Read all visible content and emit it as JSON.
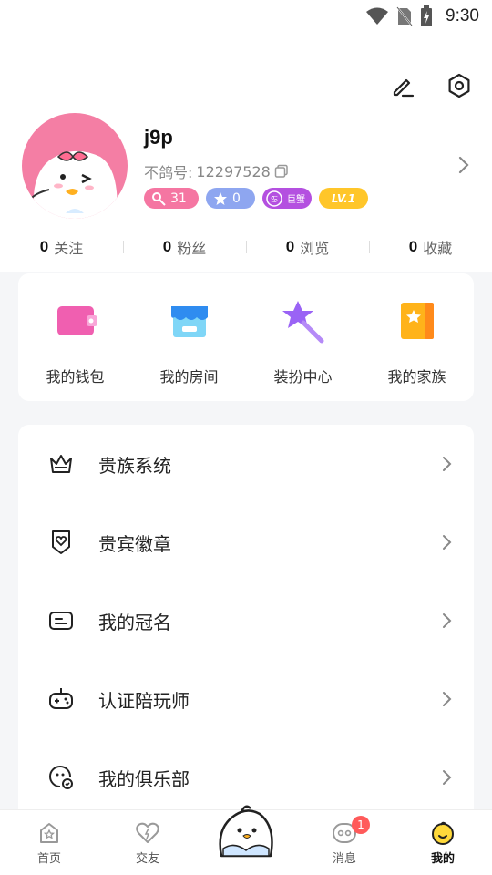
{
  "status_bar": {
    "time": "9:30"
  },
  "profile": {
    "name": "j9p",
    "uid_label": "不鸽号:",
    "uid": "12297528",
    "badges": {
      "fans_level": "31",
      "star_level": "0",
      "tag": "巨蟹",
      "level": "LV.1"
    }
  },
  "stats": [
    {
      "count": "0",
      "label": "关注"
    },
    {
      "count": "0",
      "label": "粉丝"
    },
    {
      "count": "0",
      "label": "浏览"
    },
    {
      "count": "0",
      "label": "收藏"
    }
  ],
  "quick_actions": [
    {
      "label": "我的钱包",
      "icon": "wallet-icon",
      "color": "#f05fb0"
    },
    {
      "label": "我的房间",
      "icon": "store-icon",
      "color": "#3aa2f5"
    },
    {
      "label": "装扮中心",
      "icon": "magic-wand-icon",
      "color": "#9a63f5"
    },
    {
      "label": "我的家族",
      "icon": "family-book-icon",
      "color": "#ffb31a"
    }
  ],
  "menu": [
    {
      "label": "贵族系统",
      "icon": "crown-icon"
    },
    {
      "label": "贵宾徽章",
      "icon": "heart-badge-icon"
    },
    {
      "label": "我的冠名",
      "icon": "nameplate-icon"
    },
    {
      "label": "认证陪玩师",
      "icon": "gamepad-icon"
    },
    {
      "label": "我的俱乐部",
      "icon": "club-icon"
    }
  ],
  "tabs": [
    {
      "label": "首页",
      "icon": "home-icon"
    },
    {
      "label": "交友",
      "icon": "heart-icon"
    },
    {
      "label": "",
      "icon": "mascot-icon"
    },
    {
      "label": "消息",
      "icon": "message-icon",
      "badge": "1"
    },
    {
      "label": "我的",
      "icon": "profile-face-icon",
      "active": true
    }
  ],
  "colors": {
    "accent_pink": "#f576a2",
    "accent_yellow": "#ffc62a",
    "background": "#f5f6f8"
  }
}
